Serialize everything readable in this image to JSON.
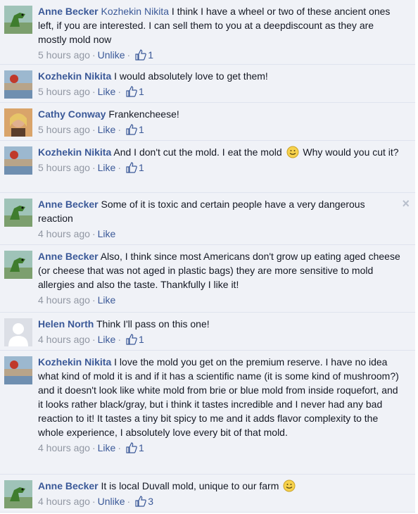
{
  "comments": [
    {
      "author": "Anne Becker",
      "avatar": "dinosaur-avatar",
      "mention": "Kozhekin Nikita",
      "text": " I think I have a wheel or two of these ancient ones left, if you are interested. I can sell them to you at a deepdiscount as they are mostly mold now",
      "time": "5 hours ago",
      "action": "Unlike",
      "likes": "1"
    },
    {
      "author": "Kozhekin Nikita",
      "avatar": "coast-avatar",
      "text": "I would absolutely love to get them!",
      "time": "5 hours ago",
      "action": "Like",
      "likes": "1"
    },
    {
      "author": "Cathy Conway",
      "avatar": "portrait-avatar",
      "text": "Frankencheese!",
      "time": "5 hours ago",
      "action": "Like",
      "likes": "1"
    },
    {
      "author": "Kozhekin Nikita",
      "avatar": "coast-avatar",
      "text": "And I don't cut the mold. I eat the mold",
      "text_after_emoji": " Why would you cut it?",
      "time": "5 hours ago",
      "action": "Like",
      "likes": "1"
    },
    {
      "author": "Anne Becker",
      "avatar": "dinosaur-avatar",
      "text": "Some of it is toxic and certain people have a very dangerous reaction",
      "time": "4 hours ago",
      "action": "Like",
      "close": "×"
    },
    {
      "author": "Anne Becker",
      "avatar": "dinosaur-avatar",
      "text": "Also, I think since most Americans don't grow up eating aged cheese (or cheese that was not aged in plastic bags) they are more sensitive to mold allergies and also the taste. Thankfully I like it!",
      "time": "4 hours ago",
      "action": "Like"
    },
    {
      "author": "Helen North",
      "avatar": "default-avatar",
      "text": "Think I'll pass on this one!",
      "time": "4 hours ago",
      "action": "Like",
      "likes": "1"
    },
    {
      "author": "Kozhekin Nikita",
      "avatar": "coast-avatar",
      "text": "I love the mold you get on the premium reserve. I have no idea what kind of mold it is and if it has a scientific name (it is some kind of mushroom?) and it doesn't look like white mold from brie or blue mold from inside roquefort, and it looks rather black/gray, but i think it tastes incredible and I never had any bad reaction to it! It tastes a tiny bit spicy to me and it adds flavor complexity to the whole experience, I absolutely love every bit of that mold.",
      "time": "4 hours ago",
      "action": "Like",
      "likes": "1"
    },
    {
      "author": "Anne Becker",
      "avatar": "dinosaur-avatar",
      "text": "It is local Duvall mold, unique to our farm",
      "time": "4 hours ago",
      "action": "Unlike",
      "likes": "3"
    }
  ],
  "colors": {
    "link": "#3b5998",
    "meta": "#9197a3",
    "background": "#f0f2f7"
  }
}
